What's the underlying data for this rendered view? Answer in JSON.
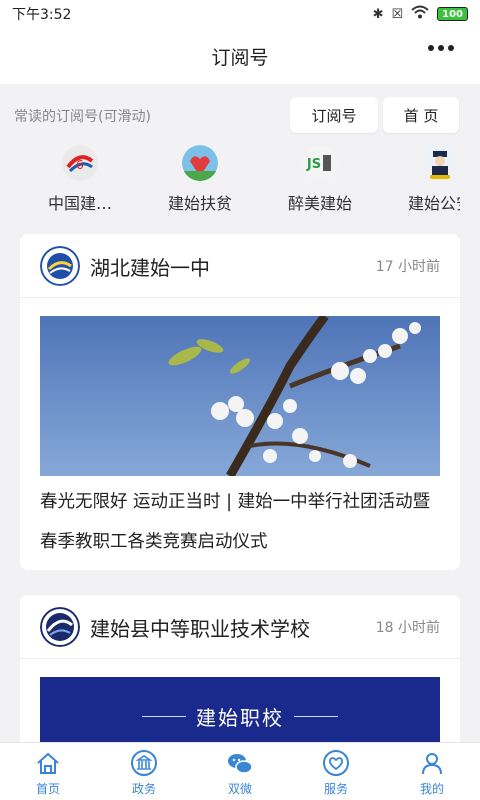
{
  "status": {
    "time": "下午3:52",
    "battery": "100"
  },
  "header": {
    "title": "订阅号"
  },
  "subscription": {
    "hint": "常读的订阅号(可滑动)",
    "btn_subscribe": "订阅号",
    "btn_home": "首 页"
  },
  "channels": [
    {
      "label": "中国建…",
      "icon": "china-construction-logo-icon"
    },
    {
      "label": "建始扶贫",
      "icon": "poverty-alleviation-logo-icon"
    },
    {
      "label": "醉美建始",
      "icon": "js-logo-icon"
    },
    {
      "label": "建始公安",
      "icon": "police-logo-icon"
    }
  ],
  "cards": [
    {
      "name": "湖北建始一中",
      "time": "17 小时前",
      "title": "春光无限好 运动正当时 | 建始一中举行社团活动暨春季教职工各类竞赛启动仪式"
    },
    {
      "name": "建始县中等职业技术学校",
      "time": "18 小时前",
      "banner_text": "建始职校"
    }
  ],
  "tabs": [
    {
      "label": "首页",
      "icon": "home-icon"
    },
    {
      "label": "政务",
      "icon": "government-icon"
    },
    {
      "label": "双微",
      "icon": "weibo-wechat-icon"
    },
    {
      "label": "服务",
      "icon": "heart-hand-icon"
    },
    {
      "label": "我的",
      "icon": "user-icon"
    }
  ],
  "colors": {
    "accent": "#3a85d4",
    "banner": "#1a2a8c"
  }
}
